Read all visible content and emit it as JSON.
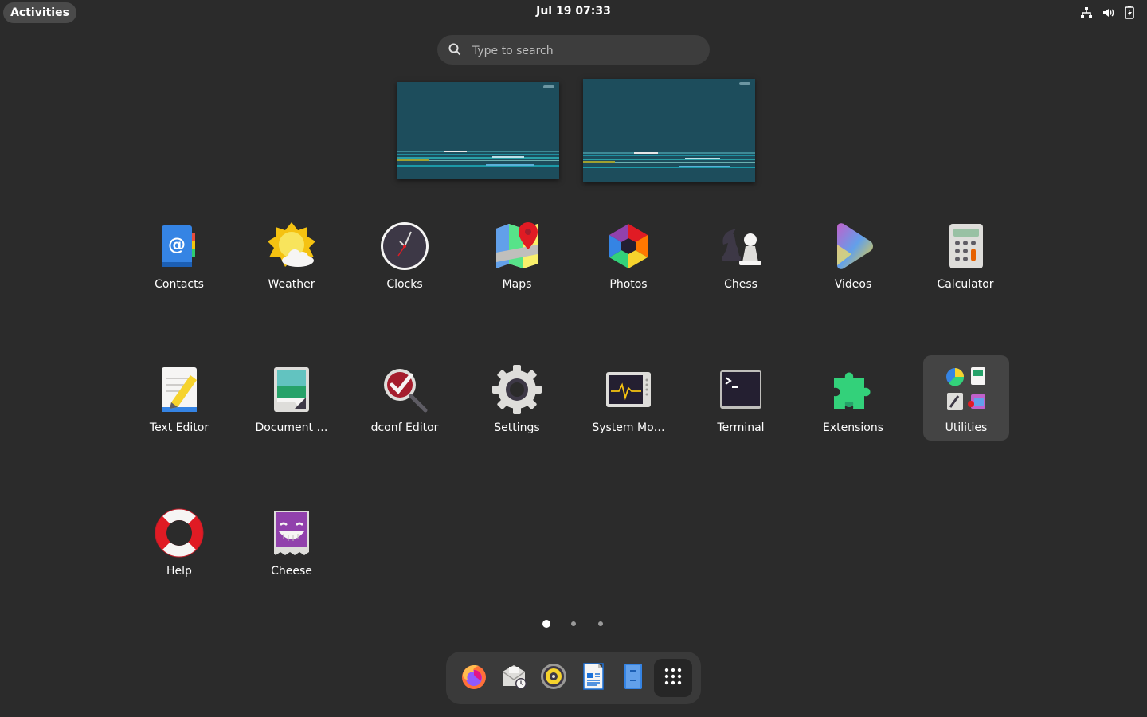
{
  "topbar": {
    "activities_label": "Activities",
    "clock": "Jul 19  07:33",
    "tray_icons": [
      "network-icon",
      "volume-icon",
      "battery-icon"
    ]
  },
  "search": {
    "placeholder": "Type to search"
  },
  "apps": [
    {
      "label": "Contacts",
      "icon": "contacts-icon"
    },
    {
      "label": "Weather",
      "icon": "weather-icon"
    },
    {
      "label": "Clocks",
      "icon": "clocks-icon"
    },
    {
      "label": "Maps",
      "icon": "maps-icon"
    },
    {
      "label": "Photos",
      "icon": "photos-icon"
    },
    {
      "label": "Chess",
      "icon": "chess-icon"
    },
    {
      "label": "Videos",
      "icon": "videos-icon"
    },
    {
      "label": "Calculator",
      "icon": "calculator-icon"
    },
    {
      "label": "Text Editor",
      "icon": "text-editor-icon"
    },
    {
      "label": "Document …",
      "icon": "document-viewer-icon"
    },
    {
      "label": "dconf Editor",
      "icon": "dconf-editor-icon"
    },
    {
      "label": "Settings",
      "icon": "settings-icon"
    },
    {
      "label": "System Mo…",
      "icon": "system-monitor-icon"
    },
    {
      "label": "Terminal",
      "icon": "terminal-icon"
    },
    {
      "label": "Extensions",
      "icon": "extensions-icon"
    },
    {
      "label": "Utilities",
      "icon": "utilities-folder-icon",
      "selected": true
    },
    {
      "label": "Help",
      "icon": "help-icon"
    },
    {
      "label": "Cheese",
      "icon": "cheese-icon"
    }
  ],
  "pagination": {
    "pages": 3,
    "current": 1
  },
  "dock": [
    "firefox-icon",
    "mail-icon",
    "rhythmbox-icon",
    "writer-icon",
    "files-icon",
    "show-apps-icon"
  ],
  "colors": {
    "background": "#2b2b2b",
    "workspace": "#1d4d5c",
    "search_bg": "#3d3d3d",
    "dock_bg": "#3a3a3a"
  }
}
